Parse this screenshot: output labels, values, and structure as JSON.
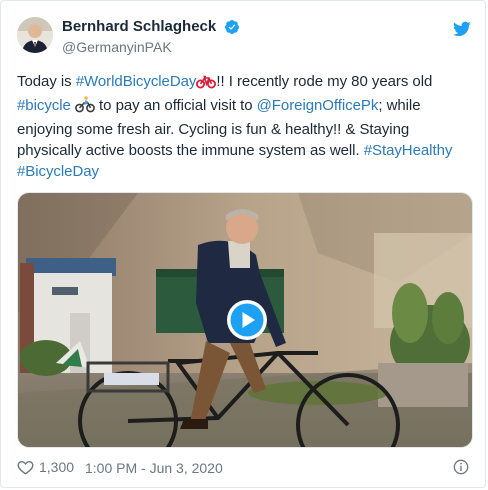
{
  "author": {
    "display_name": "Bernhard Schlagheck",
    "handle": "@GermanyinPAK",
    "verified": true
  },
  "tweet": {
    "segments": [
      {
        "text": "Today is ",
        "link": false
      },
      {
        "text": "#WorldBicycleDay",
        "link": true
      },
      {
        "emoji": "bicycle-icon"
      },
      {
        "text": "!! I recently rode my 80 years old ",
        "link": false
      },
      {
        "text": "#bicycle",
        "link": true
      },
      {
        "text": " ",
        "link": false
      },
      {
        "emoji": "person-biking-icon"
      },
      {
        "text": " to pay an official visit to  ",
        "link": false
      },
      {
        "text": "@ForeignOfficePk",
        "link": true
      },
      {
        "text": "; while enjoying some fresh air. Cycling is fun & healthy!! & Staying physically active boosts the immune system as well. ",
        "link": false
      },
      {
        "text": "#StayHealthy",
        "link": true
      },
      {
        "text": " ",
        "link": false
      },
      {
        "text": "#BicycleDay",
        "link": true
      }
    ]
  },
  "media": {
    "type": "video",
    "play_icon": "play-icon"
  },
  "footer": {
    "like_count": "1,300",
    "timestamp": "1:00 PM - Jun 3, 2020"
  },
  "icons": {
    "brand": "twitter-bird-icon",
    "verified": "verified-badge-icon",
    "like": "heart-icon",
    "info": "info-icon"
  },
  "colors": {
    "link": "#2b7bb9",
    "text": "#1c2938",
    "muted": "#697882",
    "brand": "#1da1f2",
    "border": "#e1e8ed"
  }
}
